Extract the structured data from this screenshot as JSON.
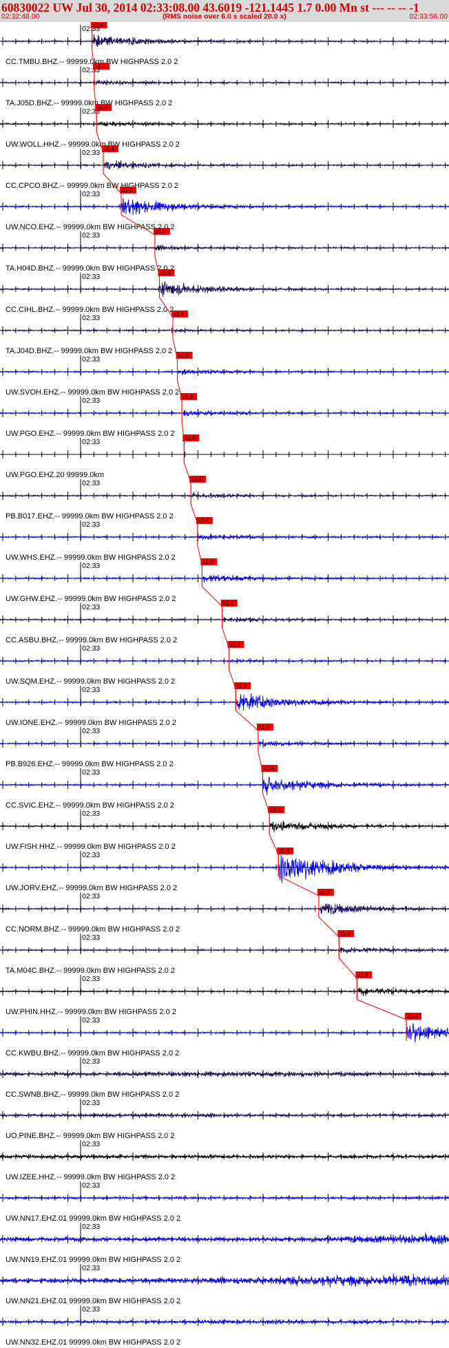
{
  "header": {
    "title": "60830022 UW Jul 30, 2014 02:33:08.00   43.6019 -121.1445  1.7 0.00 Mn st --- -- --  -1",
    "subtitle": "(RMS noise over 6.0 s scaled 20.0 x)",
    "time_start": "02:32:48.00",
    "time_end": "02:33:56.00"
  },
  "colors": {
    "background": "#ffffff",
    "header_bg": "#d9d9d9",
    "header_text": "#cc0000",
    "pick": "#ee0000",
    "axis": "#000000"
  },
  "chart_data": {
    "type": "seismogram",
    "title": "60830022 UW Jul 30, 2014 02:33:08.00   43.6019 -121.1445  1.7 0.00 Mn st --- -- --  -1",
    "subtitle": "(RMS noise over 6.0 s scaled 20.0 x)",
    "xlim": [
      "02:32:48.00",
      "02:33:56.00"
    ],
    "time_mark_label": "02:33",
    "pick_label": "x1.4",
    "traces": [
      {
        "label": "CC.TMBU.BHZ.-- 99999.0km BW  HIGHPASS  2.0  2",
        "color": "#1a0a5a",
        "pick": 0.205,
        "amp": 0.35
      },
      {
        "label": "TA.J05D.BHZ.-- 99999.0km BW  HIGHPASS  2.0  2",
        "color": "#1a0a5a",
        "pick": 0.21,
        "amp": 0.1
      },
      {
        "label": "UW.WOLL.HHZ.-- 99999.0km BW  HIGHPASS  2.0  2",
        "color": "#000000",
        "pick": 0.215,
        "amp": 0.12
      },
      {
        "label": "CC.CPCO.BHZ.-- 99999.0km BW  HIGHPASS  2.0  2",
        "color": "#1a0a5a",
        "pick": 0.23,
        "amp": 0.2
      },
      {
        "label": "UW.NCO.EHZ.-- 99999.0km BW  HIGHPASS  2.0  2",
        "color": "#0000ee",
        "pick": 0.27,
        "amp": 0.5
      },
      {
        "label": "TA.H04D.BHZ.-- 99999.0km BW  HIGHPASS  2.0  2",
        "color": "#1a0a5a",
        "pick": 0.345,
        "amp": 0.1
      },
      {
        "label": "CC.CIHL.BHZ.-- 99999.0km BW  HIGHPASS  2.0  2",
        "color": "#1a0a5a",
        "pick": 0.355,
        "amp": 0.4
      },
      {
        "label": "TA.J04D.BHZ.-- 99999.0km BW  HIGHPASS  2.0  2",
        "color": "#1a0a5a",
        "pick": 0.385,
        "amp": 0.05
      },
      {
        "label": "UW.SVOH.EHZ.-- 99999.0km BW  HIGHPASS  2.0  2",
        "color": "#0000ee",
        "pick": 0.395,
        "amp": 0.12
      },
      {
        "label": "UW.PGO.EHZ.-- 99999.0km BW  HIGHPASS  2.0  2",
        "color": "#0000ee",
        "pick": 0.405,
        "amp": 0.15
      },
      {
        "label": "UW.PGO.EHZ.20 99999.0km",
        "color": "#0000ee",
        "pick": 0.41,
        "amp": 0.0
      },
      {
        "label": "PB.B017.EHZ.-- 99999.0km BW  HIGHPASS  2.0  2",
        "color": "#1a0a5a",
        "pick": 0.425,
        "amp": 0.12
      },
      {
        "label": "UW.WHS.EHZ.-- 99999.0km BW  HIGHPASS  2.0  2",
        "color": "#0000ee",
        "pick": 0.44,
        "amp": 0.15
      },
      {
        "label": "UW.GHW.EHZ.-- 99999.0km BW  HIGHPASS  2.0  2",
        "color": "#0000ee",
        "pick": 0.45,
        "amp": 0.2
      },
      {
        "label": "CC.ASBU.BHZ.-- 99999.0km BW  HIGHPASS  2.0  2",
        "color": "#1a0a5a",
        "pick": 0.495,
        "amp": 0.12
      },
      {
        "label": "UW.SQM.EHZ.-- 99999.0km BW  HIGHPASS  2.0  2",
        "color": "#0000ee",
        "pick": 0.51,
        "amp": 0.05
      },
      {
        "label": "UW.IONE.EHZ.-- 99999.0km BW  HIGHPASS  2.0  2",
        "color": "#0000ee",
        "pick": 0.525,
        "amp": 0.5
      },
      {
        "label": "PB.B926.EHZ.-- 99999.0km BW  HIGHPASS  2.0  2",
        "color": "#0000ee",
        "pick": 0.575,
        "amp": 0.12
      },
      {
        "label": "CC.SVIC.EHZ.-- 99999.0km BW  HIGHPASS  2.0  2",
        "color": "#0000ee",
        "pick": 0.585,
        "amp": 0.45
      },
      {
        "label": "UW.FISH.HHZ.-- 99999.0km BW  HIGHPASS  2.0  2",
        "color": "#000000",
        "pick": 0.6,
        "amp": 0.35
      },
      {
        "label": "UW.JORV.EHZ.-- 99999.0km BW  HIGHPASS  2.0  2",
        "color": "#0000ee",
        "pick": 0.62,
        "amp": 0.95
      },
      {
        "label": "CC.NORM.BHZ.-- 99999.0km BW  HIGHPASS  2.0  2",
        "color": "#1a0a5a",
        "pick": 0.71,
        "amp": 0.35
      },
      {
        "label": "TA.M04C.BHZ.-- 99999.0km BW  HIGHPASS  2.0  2",
        "color": "#1a0a5a",
        "pick": 0.755,
        "amp": 0.15
      },
      {
        "label": "UW.PHIN.HHZ.-- 99999.0km BW  HIGHPASS  2.0  2",
        "color": "#000000",
        "pick": 0.795,
        "amp": 0.2
      },
      {
        "label": "CC.KWBU.BHZ.-- 99999.0km BW  HIGHPASS  2.0  2",
        "color": "#0000ee",
        "pick": 0.905,
        "amp": 0.5
      },
      {
        "label": "CC.SWNB.BHZ.-- 99999.0km BW  HIGHPASS  2.0  2",
        "color": "#1a0a5a",
        "pick": null,
        "amp": 0.15
      },
      {
        "label": "UO.PINE.BHZ.-- 99999.0km BW  HIGHPASS  2.0  2",
        "color": "#1a0a5a",
        "pick": null,
        "amp": 0.12
      },
      {
        "label": "UW.IZEE.HHZ.-- 99999.0km BW  HIGHPASS  2.0  2",
        "color": "#000000",
        "pick": null,
        "amp": 0.18
      },
      {
        "label": "UW.NN17.EHZ.01 99999.0km BW  HIGHPASS  2.0  2",
        "color": "#0000ee",
        "pick": null,
        "amp": 0.08
      },
      {
        "label": "UW.NN19.EHZ.01 99999.0km BW  HIGHPASS  2.0  2",
        "color": "#0000ee",
        "pick": null,
        "amp": 0.25
      },
      {
        "label": "UW.NN21.EHZ.01 99999.0km BW  HIGHPASS  2.0  2",
        "color": "#0000ee",
        "pick": null,
        "amp": 0.3
      },
      {
        "label": "UW.NN32.EHZ.01 99999.0km BW  HIGHPASS  2.0  2",
        "color": "#0000ee",
        "pick": null,
        "amp": 0.1
      }
    ]
  }
}
